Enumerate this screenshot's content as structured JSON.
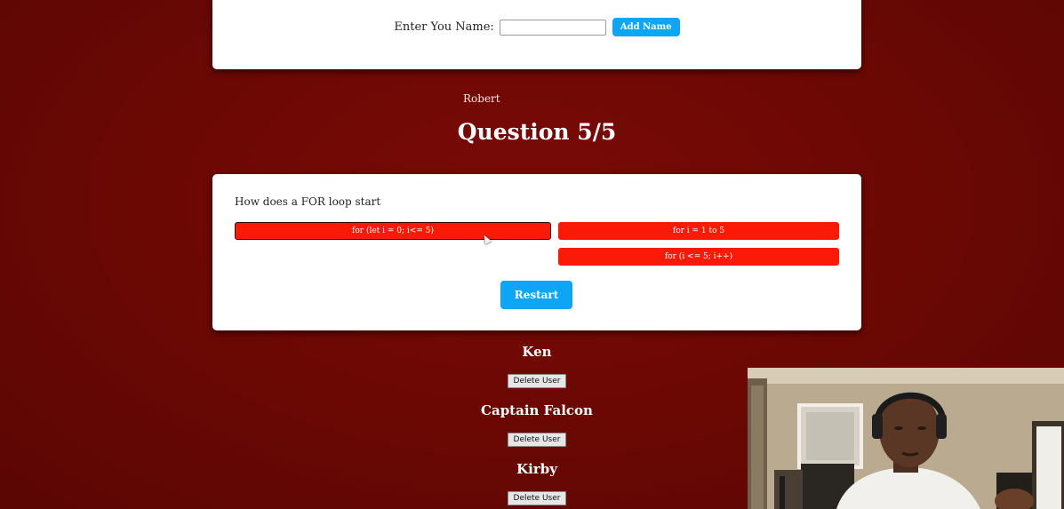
{
  "name_form": {
    "label": "Enter You Name:",
    "input_value": "",
    "input_placeholder": "",
    "add_button_label": "Add Name"
  },
  "current_user": "Robert",
  "question": {
    "title": "Question 5/5",
    "text": "How does a FOR loop start",
    "answers": [
      {
        "label": "for (let i = 0; i<= 5)",
        "selected": true
      },
      {
        "label": "for i = 1 to 5",
        "selected": false
      },
      {
        "label": "for (i <= 5; i++)",
        "selected": false
      }
    ],
    "restart_label": "Restart"
  },
  "users": [
    {
      "name": "Ken",
      "delete_label": "Delete User"
    },
    {
      "name": "Captain Falcon",
      "delete_label": "Delete User"
    },
    {
      "name": "Kirby",
      "delete_label": "Delete User"
    }
  ],
  "colors": {
    "background": "#6a0804",
    "answer_button": "#fb1a07",
    "primary_button": "#0ea5f5",
    "card": "#ffffff"
  },
  "webcam": {
    "icon": "presenter-video-icon"
  }
}
